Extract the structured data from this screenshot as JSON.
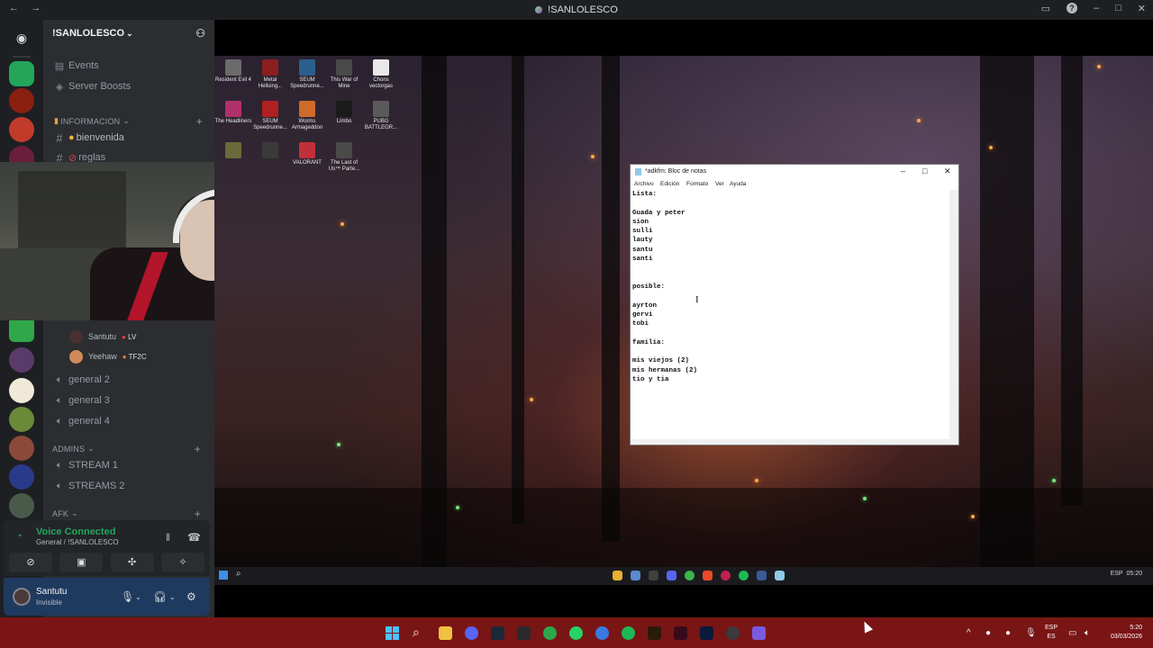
{
  "window": {
    "title": "!SANLOLESCO",
    "nav_back": "←",
    "nav_forward": "→",
    "help": "?",
    "minimize": "–",
    "maximize": "□",
    "close": "✕"
  },
  "server": {
    "name": "!SANLOLESCO",
    "chevron": "⌄"
  },
  "channels": {
    "events": "Events",
    "server_boosts": "Server Boosts",
    "category_info": "INFORMACION",
    "bienvenida": "bienvenida",
    "reglas": "reglas",
    "voice_users": [
      {
        "name": "Santutu",
        "tag": "LV"
      },
      {
        "name": "Yeehaw",
        "tag": "TF2C"
      }
    ],
    "general2": "general 2",
    "general3": "general 3",
    "general4": "general 4",
    "category_admins": "ADMINS",
    "stream1": "STREAM 1",
    "streams2": "STREAMS 2",
    "category_afk": "AFK",
    "plus": "+"
  },
  "voice_panel": {
    "status": "Voice Connected",
    "location": "General / !SANLOLESCO"
  },
  "user_panel": {
    "name": "Santutu",
    "status": "Invisible"
  },
  "desktop_icons": [
    {
      "label": "Resident Evil 4",
      "color": "#6b6b6b"
    },
    {
      "label": "Metal Hellsing...",
      "color": "#8a1f1f"
    },
    {
      "label": "SEUM Speedrunne...",
      "color": "#2b5f8f"
    },
    {
      "label": "This War of Mine",
      "color": "#4a4a4a"
    },
    {
      "label": "Chons vectorgas",
      "color": "#e8e8e8"
    },
    {
      "label": "The Headliners",
      "color": "#b0306a"
    },
    {
      "label": "SEUM Speedrunne...",
      "color": "#b02020"
    },
    {
      "label": "Worms Armageddon",
      "color": "#d06a2a"
    },
    {
      "label": "Limbo",
      "color": "#1a1a1a"
    },
    {
      "label": "PUBG BATTLEGR...",
      "color": "#5a5a5a"
    },
    {
      "label": "",
      "color": "#6a6a3a"
    },
    {
      "label": "",
      "color": "#3a3a3a"
    },
    {
      "label": "VALORANT",
      "color": "#c0303a"
    },
    {
      "label": "The Last of Us™ Parte...",
      "color": "#4a4a4a"
    }
  ],
  "notepad": {
    "title": "*adkfm: Bloc de notas",
    "menu": [
      "Archivo",
      "Edición",
      "Formato",
      "Ver",
      "Ayuda"
    ],
    "content": "Lista:\n\nGuada y peter\nsion\nsulli\nlauty\nsantu\nsanti\n\n\nposible:\n\nayrton\ngervi\ntobi\n\nfamilia:\n\nmis viejos (2)\nmis hermanas (2)\ntio y tia"
  },
  "inner_taskbar": {
    "lang": "ESP",
    "time": "05:20"
  },
  "taskbar": {
    "lang_top": "ESP",
    "lang_bottom": "ES",
    "time": "5:20",
    "date": "03/03/2026",
    "chevron": "^"
  },
  "colors": {
    "discord_bg": "#2b2d31",
    "voice_green": "#23a55a",
    "taskbar": "#7a1515",
    "user_panel": "#1f3a5f"
  }
}
